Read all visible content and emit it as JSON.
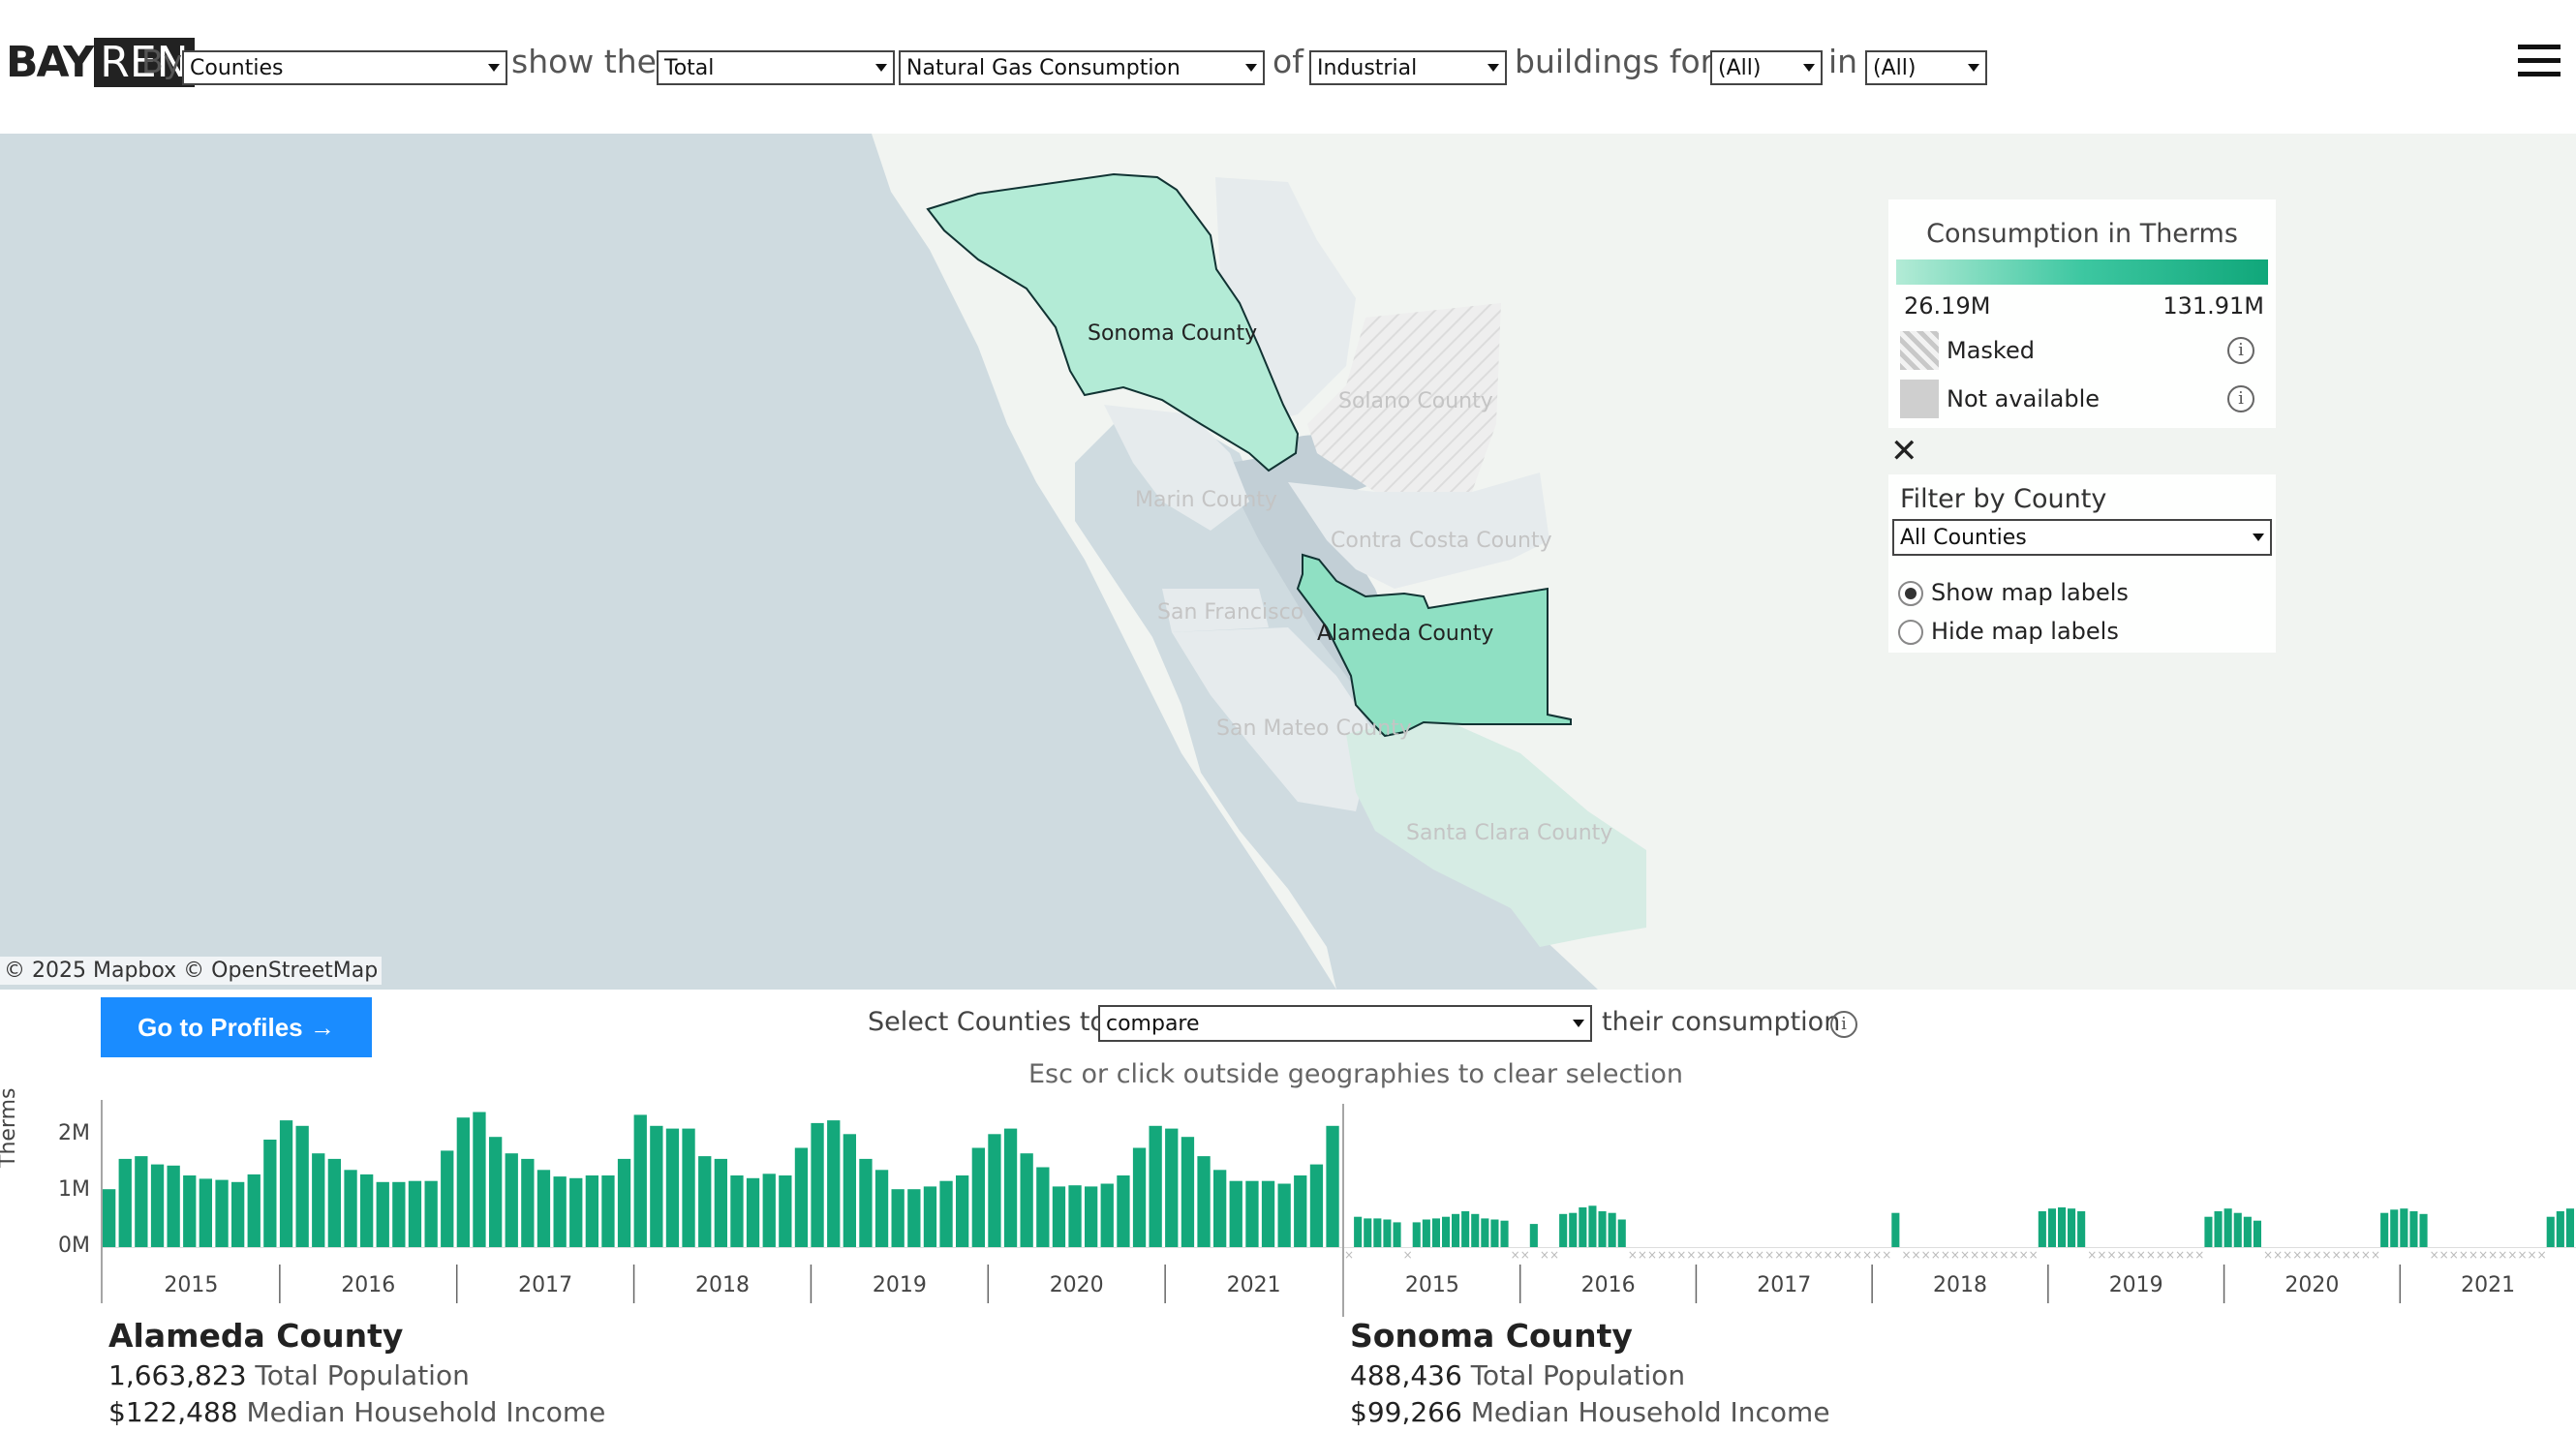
{
  "header": {
    "logo_bay": "BAY",
    "logo_ren": "REN",
    "by_label": "By",
    "geo_select": "Counties",
    "show_label": "show the",
    "agg_select": "Total",
    "metric_select": "Natural Gas Consumption",
    "of_label": "of",
    "sector_select": "Industrial",
    "buildings_label": "buildings for",
    "filter1_select": "(All)",
    "in_label": "in",
    "filter2_select": "(All)"
  },
  "map": {
    "labels": {
      "sonoma": "Sonoma County",
      "solano": "Solano County",
      "marin": "Marin County",
      "contra_costa": "Contra Costa County",
      "san_francisco": "San Francisco",
      "alameda": "Alameda County",
      "san_mateo": "San Mateo County",
      "santa_clara": "Santa Clara County"
    },
    "attribution": "© 2025 Mapbox  © OpenStreetMap",
    "colors": {
      "water": "#cfdbe0",
      "land": "#f1f4f1",
      "low": "#b3ebd6",
      "high": "#10a77a"
    }
  },
  "legend": {
    "title": "Consumption in Therms",
    "min": "26.19M",
    "max": "131.91M",
    "masked": "Masked",
    "not_available": "Not available"
  },
  "filter": {
    "title": "Filter by County",
    "select": "All Counties",
    "show_labels": "Show map labels",
    "hide_labels": "Hide map labels",
    "show_labels_selected": true
  },
  "compare": {
    "go_button": "Go to Profiles →",
    "select_label": "Select Counties to",
    "select_value": "compare",
    "their_label": "their consumption",
    "hint": "Esc or click outside geographies to clear selection"
  },
  "chart_data": [
    {
      "type": "bar",
      "name": "Alameda County",
      "ylabel": "Therms",
      "yticks": [
        "2M",
        "1M",
        "0M"
      ],
      "ylim": [
        0,
        2600000
      ],
      "x_labels": [
        "2015",
        "2016",
        "2017",
        "2018",
        "2019",
        "2020",
        "2021"
      ],
      "color": "#14a87b",
      "values": [
        1050000,
        1600000,
        1650000,
        1500000,
        1480000,
        1300000,
        1240000,
        1220000,
        1180000,
        1320000,
        1950000,
        2300000,
        2200000,
        1700000,
        1600000,
        1400000,
        1320000,
        1180000,
        1180000,
        1200000,
        1200000,
        1750000,
        2350000,
        2450000,
        2000000,
        1700000,
        1600000,
        1400000,
        1280000,
        1250000,
        1300000,
        1300000,
        1600000,
        2400000,
        2200000,
        2150000,
        2150000,
        1650000,
        1600000,
        1300000,
        1250000,
        1330000,
        1300000,
        1800000,
        2250000,
        2300000,
        2050000,
        1600000,
        1400000,
        1050000,
        1050000,
        1100000,
        1200000,
        1300000,
        1800000,
        2050000,
        2150000,
        1700000,
        1450000,
        1100000,
        1120000,
        1100000,
        1150000,
        1300000,
        1800000,
        2200000,
        2150000,
        2000000,
        1650000,
        1400000,
        1200000,
        1200000,
        1200000,
        1150000,
        1300000,
        1500000,
        2200000
      ]
    },
    {
      "type": "bar",
      "name": "Sonoma County",
      "ylabel": "Therms",
      "ylim": [
        0,
        2600000
      ],
      "x_labels": [
        "2015",
        "2016",
        "2017",
        "2018",
        "2019",
        "2020",
        "2021"
      ],
      "color": "#14a87b",
      "masked_color": "#bbbbbb",
      "values": [
        null,
        550000,
        520000,
        520000,
        500000,
        450000,
        null,
        450000,
        500000,
        520000,
        550000,
        600000,
        650000,
        600000,
        520000,
        500000,
        480000,
        null,
        null,
        420000,
        null,
        null,
        600000,
        620000,
        720000,
        750000,
        650000,
        620000,
        500000,
        null,
        null,
        null,
        null,
        null,
        null,
        null,
        null,
        null,
        null,
        null,
        null,
        null,
        null,
        null,
        null,
        null,
        null,
        null,
        null,
        null,
        null,
        null,
        null,
        null,
        null,
        null,
        620000,
        null,
        null,
        null,
        null,
        null,
        null,
        null,
        null,
        null,
        null,
        null,
        null,
        null,
        null,
        650000,
        700000,
        720000,
        700000,
        650000,
        null,
        null,
        null,
        null,
        null,
        null,
        null,
        null,
        null,
        null,
        null,
        null,
        550000,
        650000,
        700000,
        620000,
        550000,
        480000,
        null,
        null,
        null,
        null,
        null,
        null,
        null,
        null,
        null,
        null,
        null,
        null,
        620000,
        680000,
        700000,
        650000,
        600000,
        null,
        null,
        null,
        null,
        null,
        null,
        null,
        null,
        null,
        null,
        null,
        null,
        550000,
        650000,
        700000
      ]
    }
  ],
  "counties": [
    {
      "name": "Alameda County",
      "population": "1,663,823",
      "population_label": "Total Population",
      "income": "$122,488",
      "income_label": "Median Household Income"
    },
    {
      "name": "Sonoma County",
      "population": "488,436",
      "population_label": "Total Population",
      "income": "$99,266",
      "income_label": "Median Household Income"
    }
  ]
}
